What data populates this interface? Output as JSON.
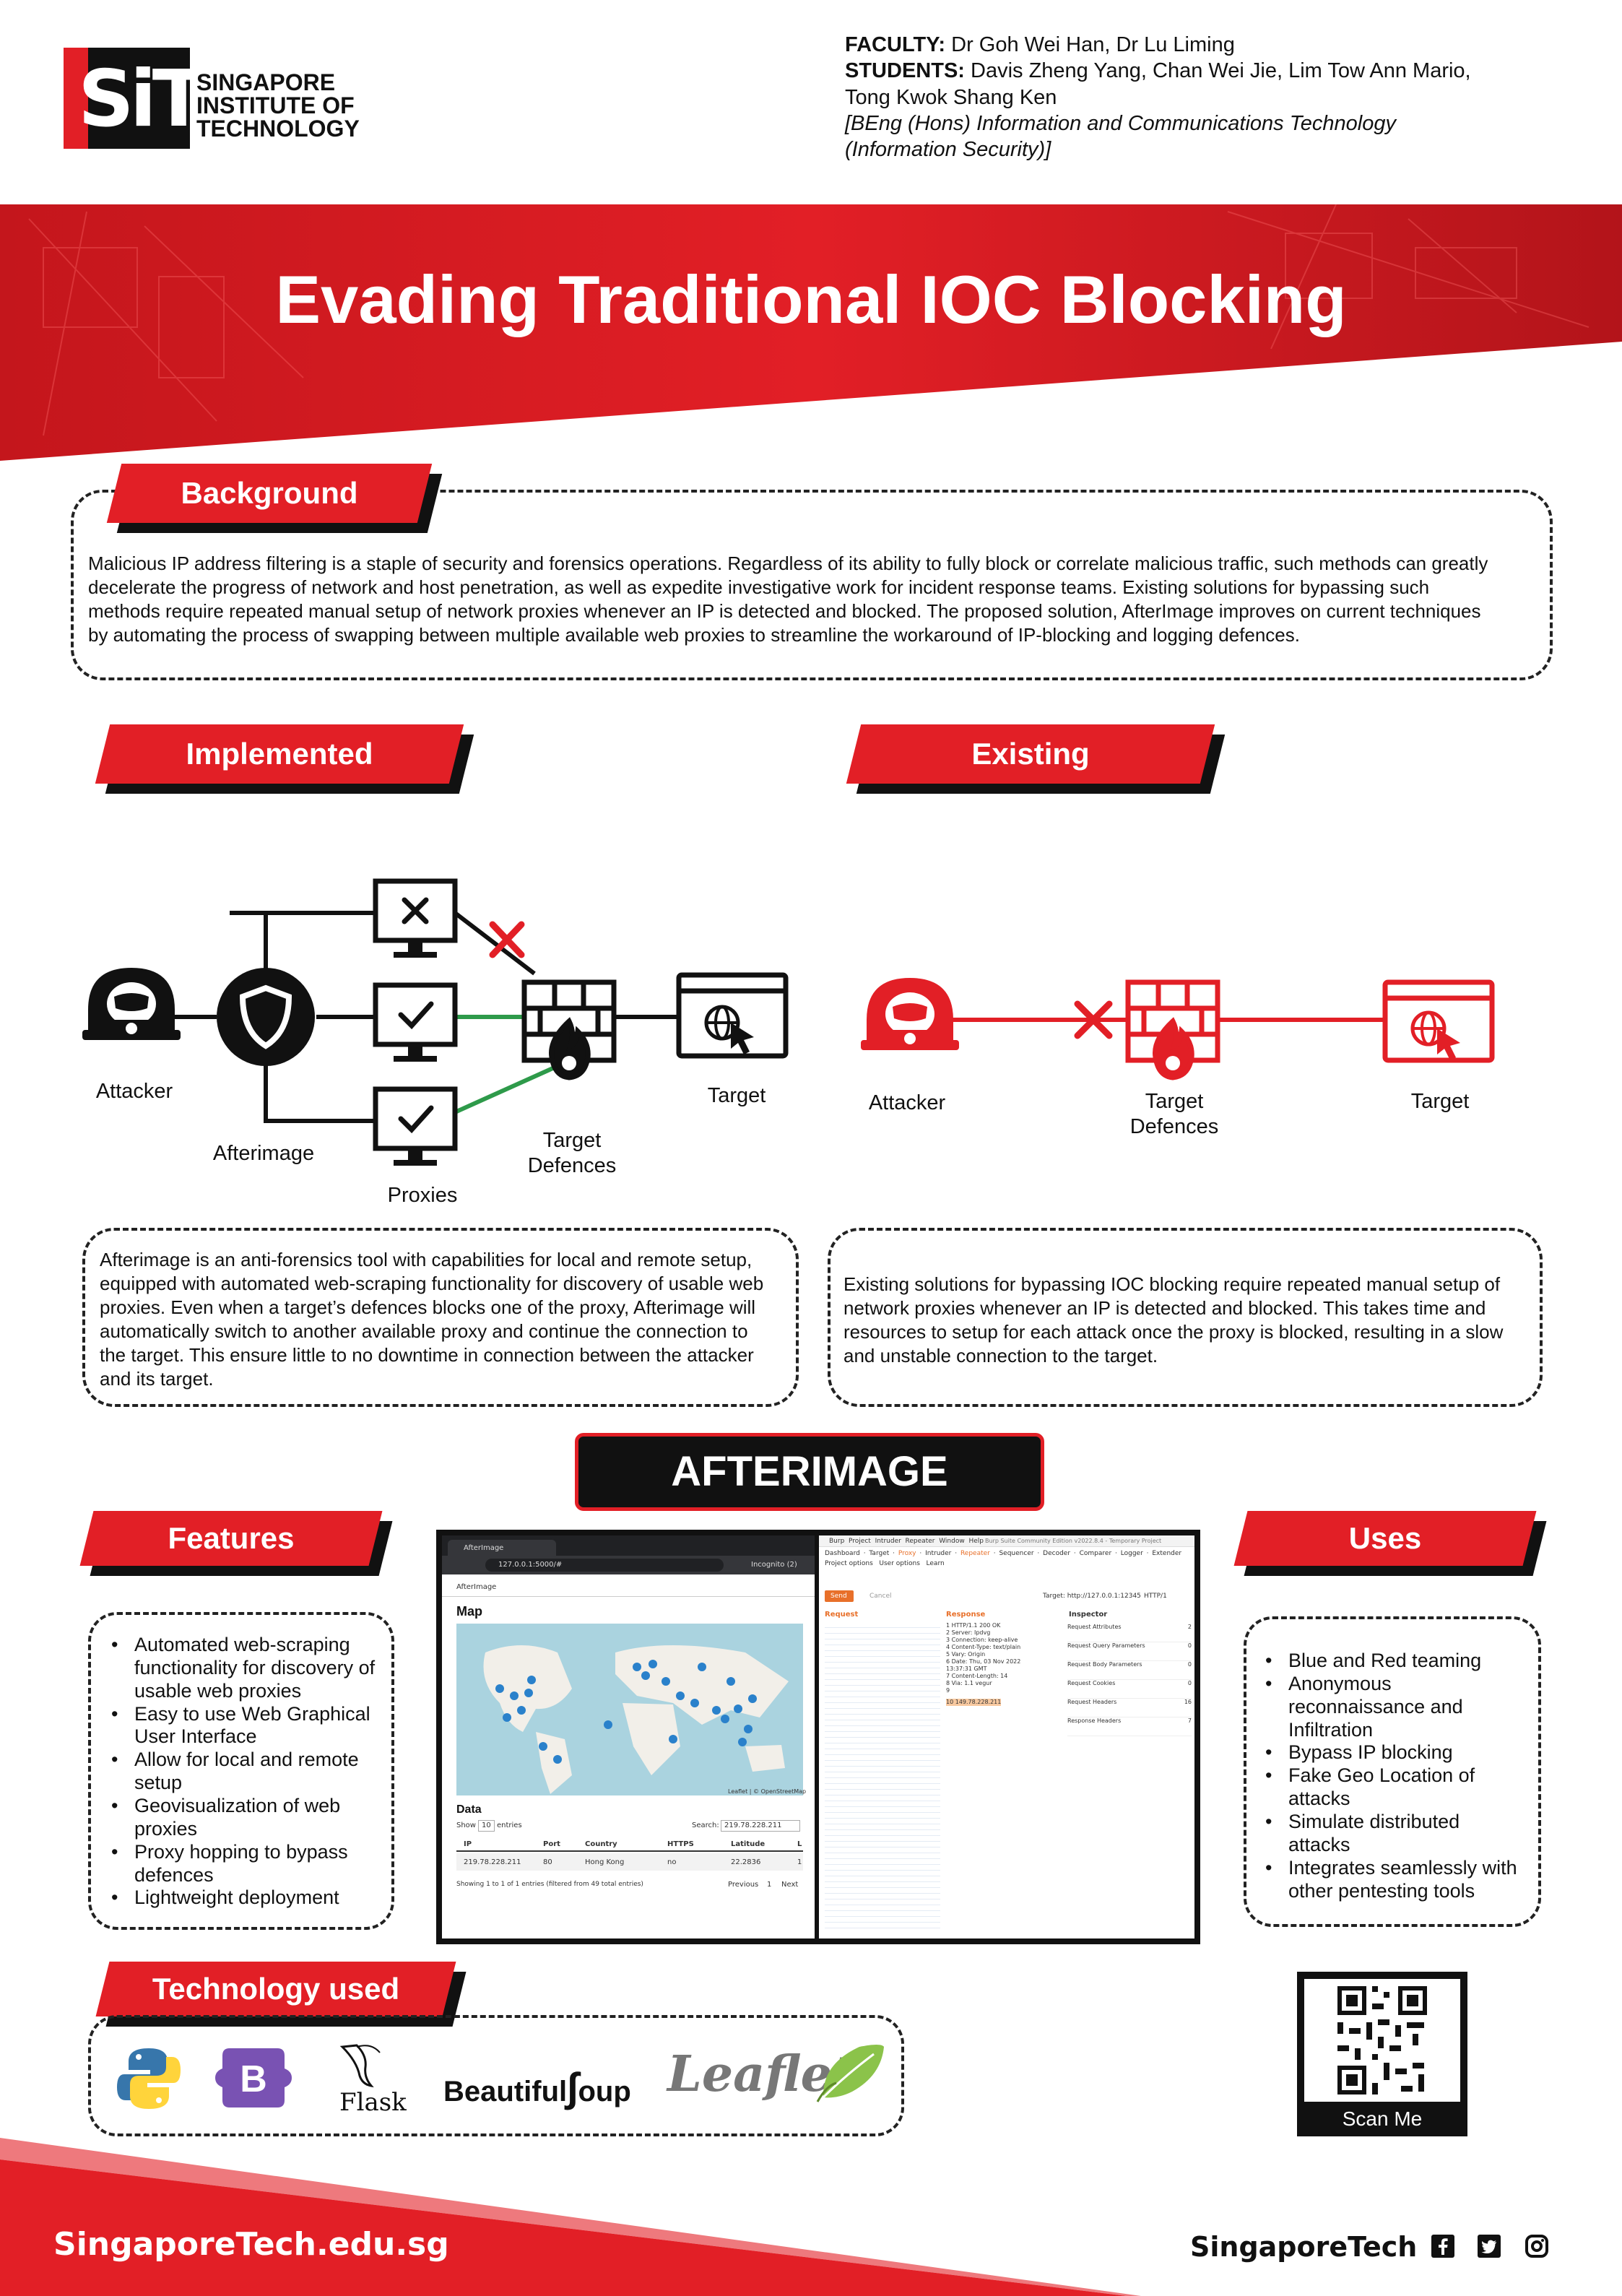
{
  "header": {
    "logo_mark": "SiT",
    "logo_lines": [
      "SINGAPORE",
      "INSTITUTE OF",
      "TECHNOLOGY"
    ],
    "faculty_label": "FACULTY:",
    "faculty": "Dr Goh Wei Han, Dr Lu Liming",
    "students_label": "STUDENTS:",
    "students_line1": "Davis Zheng Yang, Chan Wei Jie, Lim Tow Ann Mario,",
    "students_line2": "Tong Kwok Shang Ken",
    "degree_line1": "[BEng (Hons) Information and Communications Technology",
    "degree_line2": "(Information Security)]"
  },
  "title": "Evading Traditional IOC Blocking",
  "background": {
    "heading": "Background",
    "lines": [
      "Malicious IP address filtering is a staple of security and forensics operations. Regardless of its ability to fully block or correlate malicious traffic, such methods can greatly",
      "decelerate the progress of network and host penetration, as well as expedite investigative work for incident response teams. Existing solutions for bypassing such",
      "methods require repeated manual setup of network proxies whenever an IP is detected and blocked. The proposed solution, AfterImage improves on current techniques",
      "by automating the process of swapping between multiple available web proxies to streamline the workaround of IP-blocking and logging defences."
    ]
  },
  "implemented": {
    "heading": "Implemented",
    "labels": {
      "attacker": "Attacker",
      "afterimage": "Afterimage",
      "proxies": "Proxies",
      "defences_1": "Target",
      "defences_2": "Defences",
      "target": "Target"
    },
    "lines": [
      "Afterimage is an anti-forensics tool with capabilities for local and remote setup,",
      "equipped with automated web-scraping functionality for discovery of usable web",
      "proxies. Even when a target’s defences blocks one of the proxy, Afterimage will",
      "automatically switch to another available proxy and continue the connection to",
      "the target. This ensure little to no downtime in connection between the attacker",
      "and its target."
    ]
  },
  "existing": {
    "heading": "Existing",
    "labels": {
      "attacker": "Attacker",
      "defences_1": "Target",
      "defences_2": "Defences",
      "target": "Target"
    },
    "lines": [
      "Existing solutions for bypassing IOC blocking require repeated manual setup of",
      "network proxies whenever an IP is detected and blocked. This takes time and",
      "resources to setup for each attack once the proxy is blocked, resulting in a slow",
      "and unstable connection to the target."
    ]
  },
  "afterimage_banner": "AFTERIMAGE",
  "features": {
    "heading": "Features",
    "items": [
      [
        "Automated web-scraping",
        "functionality for discovery of",
        "usable web proxies"
      ],
      [
        "Easy to use Web Graphical",
        "User Interface"
      ],
      [
        "Allow for local and remote",
        "setup"
      ],
      [
        "Geovisualization of web",
        "proxies"
      ],
      [
        "Proxy hopping to bypass",
        "defences"
      ],
      [
        "Lightweight deployment"
      ]
    ]
  },
  "uses": {
    "heading": "Uses",
    "items": [
      [
        "Blue and Red teaming"
      ],
      [
        "Anonymous",
        "reconnaissance and",
        "Infiltration"
      ],
      [
        "Bypass IP blocking"
      ],
      [
        "Fake Geo Location of",
        "attacks"
      ],
      [
        "Simulate distributed",
        "attacks"
      ],
      [
        "Integrates seamlessly with",
        "other pentesting tools"
      ]
    ]
  },
  "screenshot": {
    "browser_tab": "AfterImage",
    "address": "127.0.0.1:5000/#",
    "incognito": "Incognito (2)",
    "app_title": "AfterImage",
    "map_heading": "Map",
    "map_credit": "Leaflet | © OpenStreetMap",
    "data_heading": "Data",
    "show_label": "Show",
    "show_value": "10",
    "entries_label": "entries",
    "search_label": "Search:",
    "search_value": "219.78.228.211",
    "columns": [
      "IP",
      "Port",
      "Country",
      "HTTPS",
      "Latitude",
      "L"
    ],
    "row": [
      "219.78.228.211",
      "80",
      "Hong Kong",
      "no",
      "22.2836",
      "1"
    ],
    "footer_info": "Showing 1 to 1 of 1 entries (filtered from 49 total entries)",
    "prev": "Previous",
    "page": "1",
    "next": "Next",
    "burp_menu": [
      "Burp",
      "Project",
      "Intruder",
      "Repeater",
      "Window",
      "Help"
    ],
    "burp_title": "Burp Suite Community Edition v2022.8.4 - Temporary Project",
    "burp_tabs": [
      "Dashboard",
      "Target",
      "Proxy",
      "Intruder",
      "Repeater",
      "Sequencer",
      "Decoder",
      "Comparer",
      "Logger",
      "Extender"
    ],
    "burp_subtabs": [
      "Project options",
      "User options",
      "Learn"
    ],
    "send": "Send",
    "cancel": "Cancel",
    "target": "Target: http://127.0.0.1:12345",
    "http": "HTTP/1",
    "request": "Request",
    "response": "Response",
    "inspector": "Inspector",
    "inspector_rows": [
      [
        "Request Attributes",
        "2"
      ],
      [
        "Request Query Parameters",
        "0"
      ],
      [
        "Request Body Parameters",
        "0"
      ],
      [
        "Request Cookies",
        "0"
      ],
      [
        "Request Headers",
        "16"
      ],
      [
        "Response Headers",
        "7"
      ]
    ],
    "response_lines": [
      "1 HTTP/1.1 200 OK",
      "2 Server: Ipdvg",
      "3 Connection: keep-alive",
      "4 Content-Type: text/plain",
      "5 Vary: Origin",
      "6 Date: Thu, 03 Nov 2022",
      "  13:37:31 GMT",
      "7 Content-Length: 14",
      "8 Via: 1.1 vegur",
      "9",
      "10 149.78.228.211"
    ]
  },
  "technology": {
    "heading": "Technology used",
    "bootstrap": "B",
    "flask": "Flask",
    "beautifulsoup_a": "Beautiful",
    "beautifulsoup_b": "oup",
    "leaflet": "Leaflet"
  },
  "qr_label": "Scan Me",
  "footer": {
    "url": "SingaporeTech.edu.sg",
    "brand": "SingaporeTech"
  },
  "colors": {
    "brand_red": "#e21f26",
    "ok_green": "#2e9a4a",
    "dark": "#111111"
  },
  "icons": [
    "hacker-icon",
    "shield-icon",
    "monitor-x-icon",
    "monitor-check-icon",
    "firewall-icon",
    "browser-globe-icon",
    "facebook-icon",
    "twitter-icon",
    "instagram-icon",
    "python-icon",
    "bootstrap-icon",
    "flask-icon",
    "leaf-icon"
  ]
}
